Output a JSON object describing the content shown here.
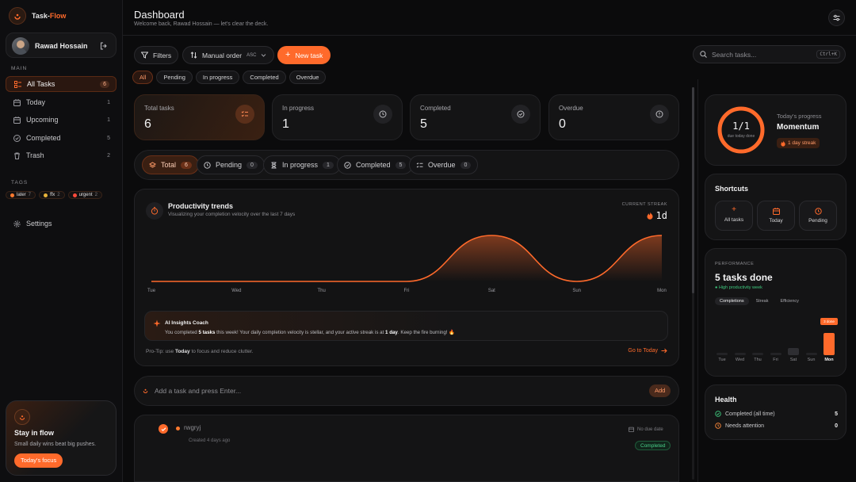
{
  "brand": {
    "name_a": "Task-",
    "name_b": "Flow"
  },
  "user": {
    "name": "Rawad Hossain"
  },
  "nav": {
    "section_main": "MAIN",
    "items": [
      {
        "label": "All Tasks",
        "count": "6"
      },
      {
        "label": "Today",
        "count": "1"
      },
      {
        "label": "Upcoming",
        "count": "1"
      },
      {
        "label": "Completed",
        "count": "5"
      },
      {
        "label": "Trash",
        "count": "2"
      }
    ],
    "section_tags": "TAGS",
    "tags": [
      {
        "label": "later",
        "count": "7",
        "color": "#ff7a2f"
      },
      {
        "label": "ffx",
        "count": "2",
        "color": "#e8b23a"
      },
      {
        "label": "urgent",
        "count": "2",
        "color": "#ff4a3a"
      }
    ],
    "settings": "Settings"
  },
  "promo": {
    "title": "Stay in flow",
    "text": "Small daily wins beat big pushes.",
    "button": "Today's focus"
  },
  "header": {
    "title": "Dashboard",
    "subtitle": "Welcome back, Rawad Hossain — let's clear the deck."
  },
  "toolbar": {
    "filters": "Filters",
    "order": "Manual order",
    "order_dir": "ASC",
    "new_task": "New task"
  },
  "search": {
    "placeholder": "Search tasks...",
    "shortcut": "Ctrl+K"
  },
  "filter_chips": [
    "All",
    "Pending",
    "In progress",
    "Completed",
    "Overdue"
  ],
  "stats": [
    {
      "label": "Total tasks",
      "value": "6"
    },
    {
      "label": "In progress",
      "value": "1"
    },
    {
      "label": "Completed",
      "value": "5"
    },
    {
      "label": "Overdue",
      "value": "0"
    }
  ],
  "segments": [
    {
      "label": "Total",
      "count": "6"
    },
    {
      "label": "Pending",
      "count": "0"
    },
    {
      "label": "In progress",
      "count": "1"
    },
    {
      "label": "Completed",
      "count": "5"
    },
    {
      "label": "Overdue",
      "count": "0"
    }
  ],
  "trends": {
    "title": "Productivity trends",
    "subtitle": "Visualizing your completion velocity over the last 7 days",
    "streak_label": "CURRENT STREAK",
    "streak_value": "1d"
  },
  "chart_data": {
    "type": "area",
    "categories": [
      "Tue",
      "Wed",
      "Thu",
      "Fri",
      "Sat",
      "Sun",
      "Mon"
    ],
    "values": [
      0,
      0,
      0,
      0,
      1,
      0,
      1
    ],
    "accent": "#ff6a2b"
  },
  "coach": {
    "title": "AI Insights Coach",
    "t1": "You completed ",
    "t2": "5 tasks",
    "t3": " this week! Your daily completion velocity is stellar, and your active streak is at ",
    "t4": "1 day",
    "t5": ". Keep the fire burning! 🔥",
    "tip_a": "Pro-Tip: use ",
    "tip_b": "Today",
    "tip_c": " to focus and reduce clutter.",
    "link": "Go to Today"
  },
  "quick_add": {
    "placeholder": "Add a task and press Enter...",
    "button": "Add"
  },
  "task": {
    "title": "rwgryj",
    "created": "Created 4 days ago",
    "due": "No due date",
    "status": "Completed"
  },
  "progress": {
    "ratio": "1/1",
    "caption": "due today done",
    "label": "Today's progress",
    "mood": "Momentum",
    "streak": "1 day streak",
    "fraction": 1
  },
  "shortcuts": {
    "title": "Shortcuts",
    "items": [
      "All tasks",
      "Today",
      "Pending"
    ]
  },
  "performance": {
    "label": "PERFORMANCE",
    "headline": "5 tasks done",
    "sub": "High productivity week",
    "tabs": [
      "Completions",
      "Streak",
      "Efficiency"
    ],
    "tooltip": "3 done",
    "days": [
      "Tue",
      "Wed",
      "Thu",
      "Fri",
      "Sat",
      "Sun",
      "Mon"
    ],
    "values": [
      0,
      0,
      0,
      0,
      1,
      0,
      3
    ]
  },
  "health": {
    "title": "Health",
    "rows": [
      {
        "label": "Completed (all time)",
        "value": "5"
      },
      {
        "label": "Needs attention",
        "value": "0"
      }
    ]
  }
}
